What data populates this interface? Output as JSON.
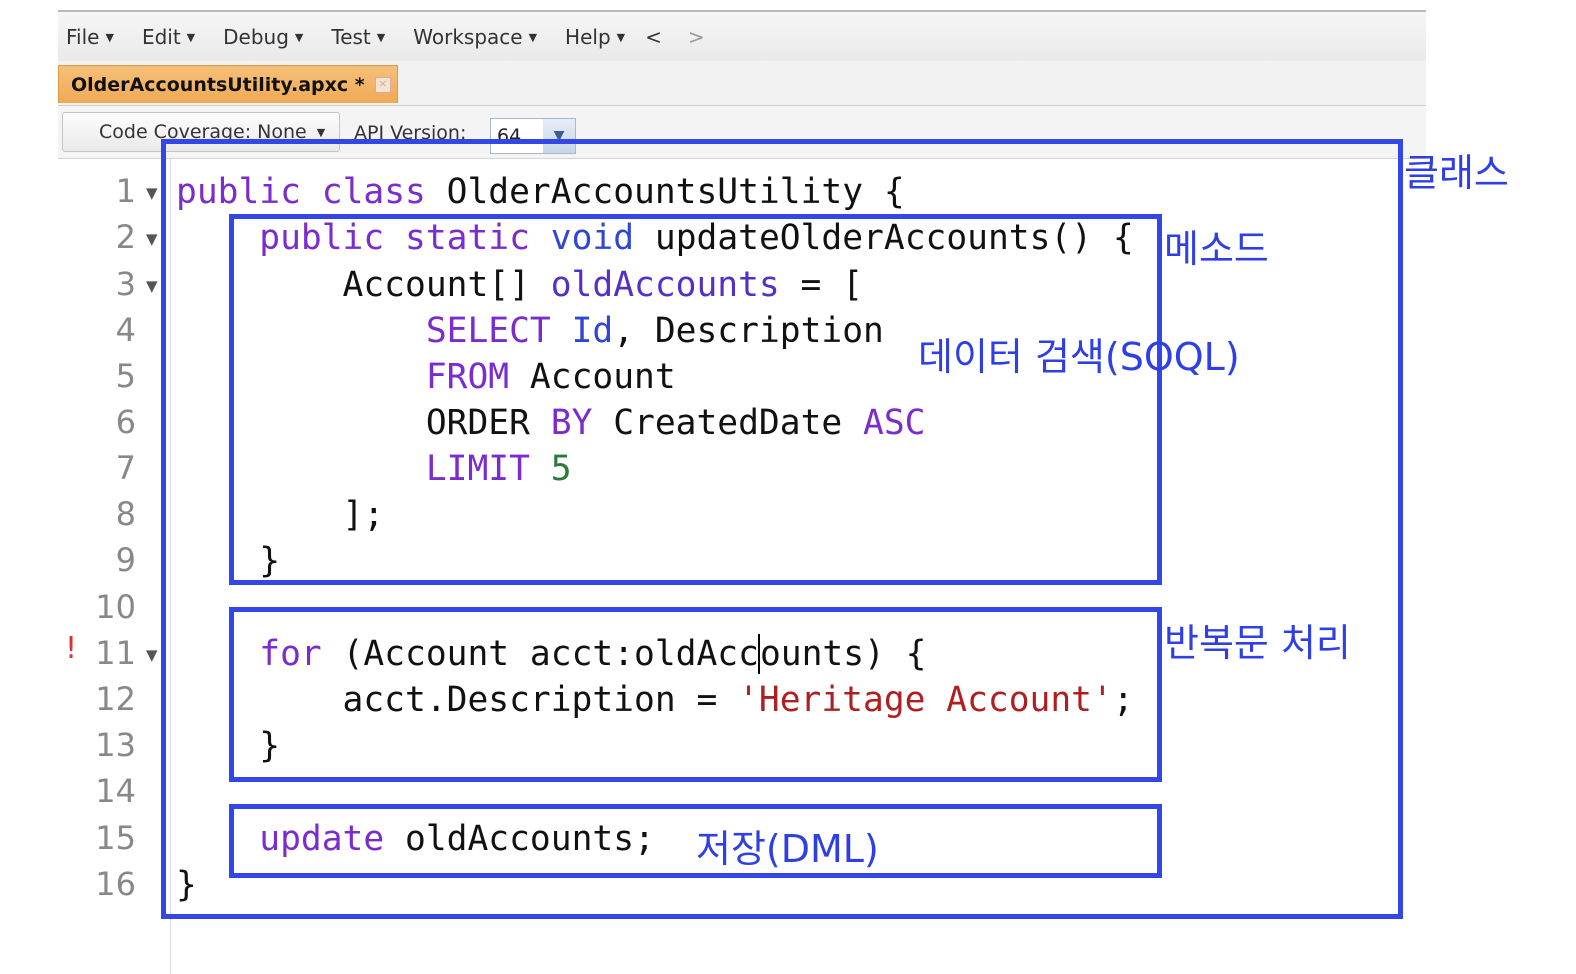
{
  "menu": {
    "items": [
      "File",
      "Edit",
      "Debug",
      "Test",
      "Workspace",
      "Help"
    ],
    "back": "<",
    "forward": ">"
  },
  "tab": {
    "label": "OlderAccountsUtility.apxc *",
    "close": "×"
  },
  "toolbar": {
    "coverage_label": "Code Coverage: None",
    "api_label": "API Version:",
    "api_value": "64"
  },
  "editor": {
    "error_marker": "!",
    "lines": [
      {
        "n": "1",
        "fold": true
      },
      {
        "n": "2",
        "fold": true
      },
      {
        "n": "3",
        "fold": true
      },
      {
        "n": "4",
        "fold": false
      },
      {
        "n": "5",
        "fold": false
      },
      {
        "n": "6",
        "fold": false
      },
      {
        "n": "7",
        "fold": false
      },
      {
        "n": "8",
        "fold": false
      },
      {
        "n": "9",
        "fold": false
      },
      {
        "n": "10",
        "fold": false
      },
      {
        "n": "11",
        "fold": true
      },
      {
        "n": "12",
        "fold": false
      },
      {
        "n": "13",
        "fold": false
      },
      {
        "n": "14",
        "fold": false
      },
      {
        "n": "15",
        "fold": false
      },
      {
        "n": "16",
        "fold": false
      }
    ],
    "code": {
      "l1_public": "public",
      "l1_class": "class",
      "l1_rest": " OlderAccountsUtility {",
      "l2_public": "public",
      "l2_static": "static",
      "l2_void": "void",
      "l2_rest": " updateOlderAccounts() {",
      "l3_type": "Account[] ",
      "l3_var": "oldAccounts",
      "l3_rest": " = [",
      "l4_select": "SELECT",
      "l4_id": "Id",
      "l4_rest": ", Description",
      "l5_from": "FROM",
      "l5_rest": " Account",
      "l6_order": "ORDER ",
      "l6_by": "BY",
      "l6_mid": " CreatedDate ",
      "l6_asc": "ASC",
      "l7_limit": "LIMIT",
      "l7_num": "5",
      "l8": "];",
      "l9": "}",
      "l11_for": "for",
      "l11_a": " (Account acct:oldAcc",
      "l11_b": "ounts) {",
      "l12_a": "acct.Description = ",
      "l12_str": "'Heritage Account'",
      "l12_b": ";",
      "l13": "}",
      "l15_update": "update",
      "l15_rest": " oldAccounts;",
      "l16": "}"
    }
  },
  "annotations": {
    "class": "클래스",
    "method": "메소드",
    "soql": "데이터 검색(SOQL)",
    "loop": "반복문 처리",
    "dml": "저장(DML)"
  },
  "colors": {
    "annotation": "#3347e6",
    "keyword": "#7a2ccf",
    "type_keyword": "#3046d6",
    "identifier": "#5530c8",
    "number": "#2a7a3a",
    "string": "#b01f1f",
    "tab_active": "#eeaa55"
  }
}
